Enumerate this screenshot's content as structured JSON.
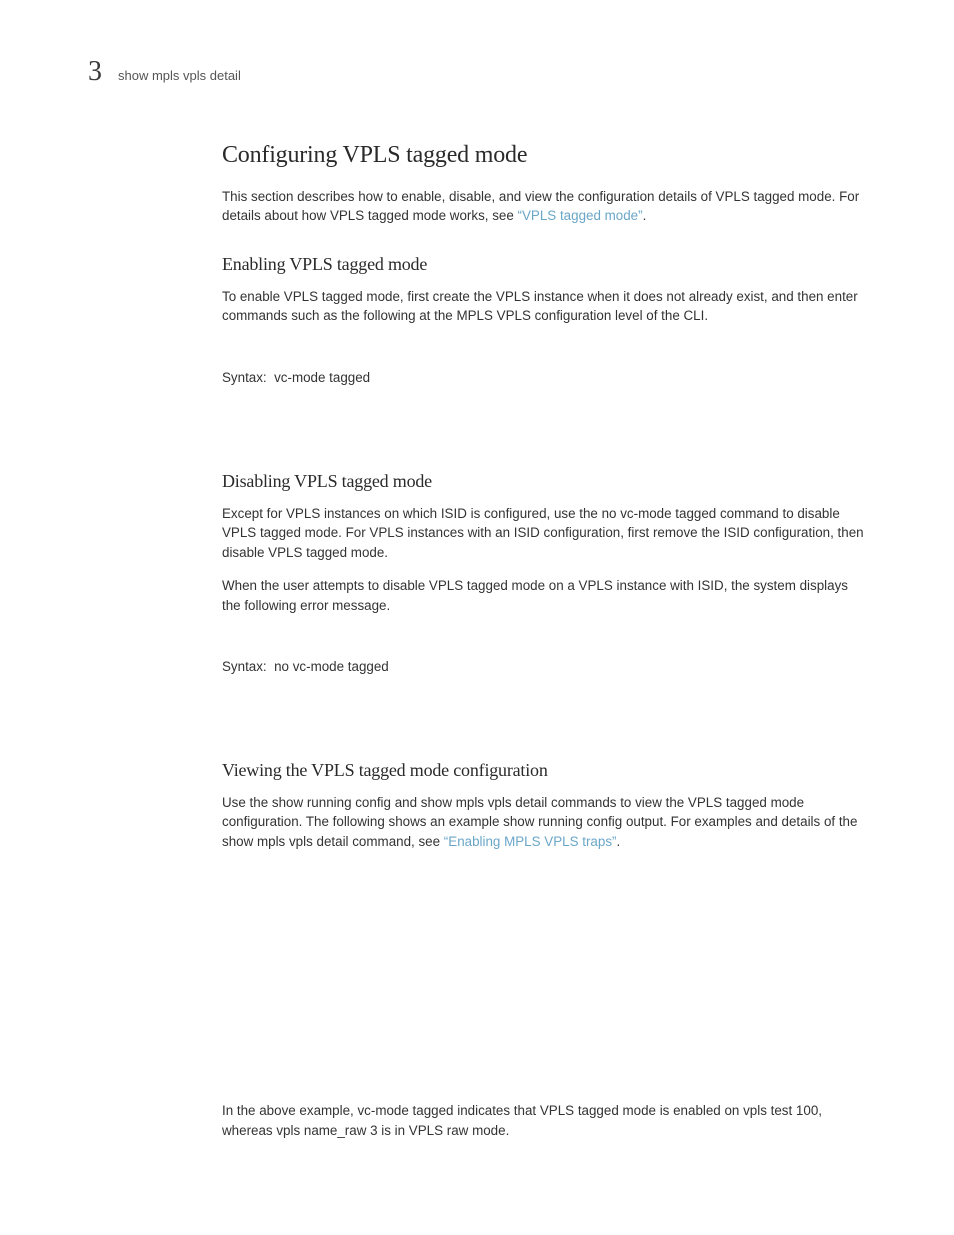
{
  "header": {
    "chapter_number": "3",
    "running_head": "show mpls vpls detail"
  },
  "section": {
    "title": "Configuring VPLS tagged mode",
    "intro_pre": "This section describes how to enable, disable, and view the configuration details of VPLS tagged mode. For details about how VPLS tagged mode works, see ",
    "intro_link": "“VPLS tagged mode”",
    "intro_post": "."
  },
  "enabling": {
    "title": "Enabling VPLS tagged mode",
    "para": "To enable VPLS tagged mode, first create the VPLS instance when it does not already exist, and then enter commands such as the following at the MPLS VPLS configuration level of the CLI.",
    "syntax": "Syntax:  vc-mode tagged"
  },
  "disabling": {
    "title": "Disabling VPLS tagged mode",
    "para1": "Except for VPLS instances on which ISID is configured, use the no vc-mode tagged command to disable VPLS tagged mode. For VPLS instances with an ISID configuration, first remove the ISID configuration, then disable VPLS tagged mode.",
    "para2": "When the user attempts to disable VPLS tagged mode on a VPLS instance with ISID, the system displays the following error message.",
    "syntax": "Syntax:  no vc-mode tagged"
  },
  "viewing": {
    "title": "Viewing the VPLS tagged mode configuration",
    "para_pre": "Use the show running config and show mpls vpls detail commands to view the VPLS tagged mode configuration. The following shows an example show running config output. For examples and details of the show mpls vpls detail command, see ",
    "para_link": "“Enabling MPLS VPLS traps”",
    "para_post": ".",
    "example_note": "In the above example, vc-mode tagged indicates that VPLS tagged mode is enabled on vpls test 100, whereas vpls name_raw 3 is in VPLS raw mode."
  }
}
